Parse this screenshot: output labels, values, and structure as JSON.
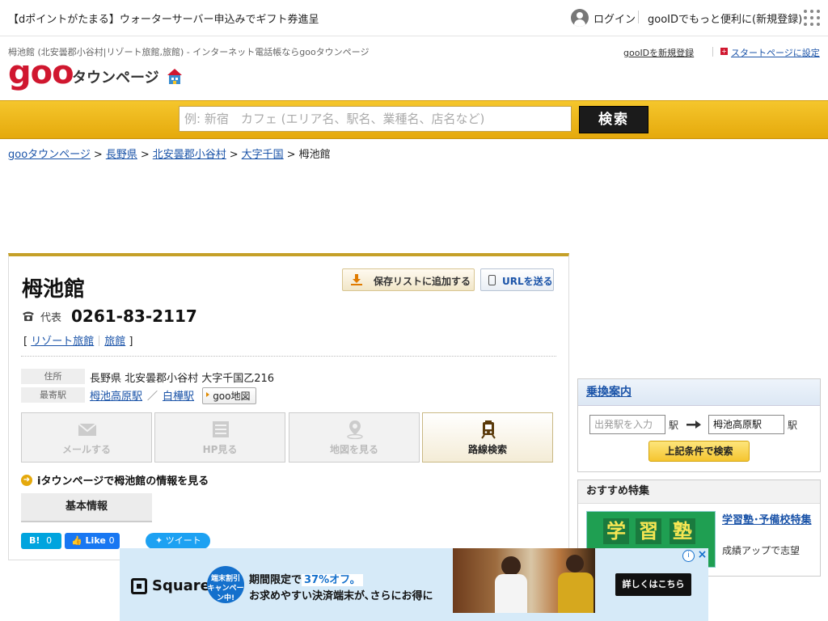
{
  "topbar": {
    "promo": "【dポイントがたまる】ウォーターサーバー申込みでギフト券進呈",
    "login": "ログイン",
    "gooid_promo": "gooIDでもっと便利に(新規登録)"
  },
  "header": {
    "description": "栂池館 (北安曇郡小谷村|リゾート旅館,旅館) - インターネット電話帳ならgooタウンページ",
    "logo_goo": "goo",
    "logo_townpage": "タウンページ",
    "register_link": "gooIDを新規登録",
    "startpage_link": "スタートページに設定"
  },
  "search": {
    "placeholder": "例: 新宿　カフェ (エリア名、駅名、業種名、店名など)",
    "button": "検索"
  },
  "breadcrumb": {
    "items": [
      "gooタウンページ",
      "長野県",
      "北安曇郡小谷村",
      "大字千国"
    ],
    "current": "栂池館",
    "sep": ">"
  },
  "shop": {
    "name": "栂池館",
    "save_button": "保存リストに追加する",
    "url_button": "URLを送る",
    "tel_label": "代表",
    "tel": "0261-83-2117",
    "bracket_open": "[",
    "bracket_close": "]",
    "categories": [
      "リゾート旅館",
      "旅館"
    ],
    "address_label": "住所",
    "address": "長野県 北安曇郡小谷村 大字千国乙216",
    "station_label": "最寄駅",
    "stations": [
      "栂池高原駅",
      "白樺駅"
    ],
    "station_sep": "／",
    "goo_map": "goo地図"
  },
  "actions": {
    "mail": "メールする",
    "hp": "HP見る",
    "map": "地図を見る",
    "route": "路線検索"
  },
  "itownpage": "iタウンページで栂池館の情報を見る",
  "tabs": {
    "basic": "基本情報"
  },
  "social": {
    "hatena": "B!",
    "hatena_count": "0",
    "fb_like": "Like",
    "fb_count": "0",
    "tweet": "ツイート"
  },
  "transit": {
    "title": "乗換案内",
    "from_placeholder": "出発駅を入力",
    "to_value": "栂池高原駅",
    "eki": "駅",
    "search_button": "上記条件で検索"
  },
  "recommend": {
    "title": "おすすめ特集",
    "thumb_chars": [
      "学",
      "習",
      "塾"
    ],
    "feature_title": "学習塾･予備校特集",
    "feature_sub": "成績アップで志望"
  },
  "ad": {
    "brand": "Square",
    "badge": "端末割引 キャンペーン中!",
    "line1_pre": "期間限定で",
    "line1_hl": "37%オフ。",
    "line2": "お求めやすい決済端末が､さらにお得に",
    "button": "詳しくはこちら",
    "info": "i",
    "close": "×"
  },
  "colors": {
    "accent_yellow": "#f5c62c",
    "logo_red": "#d0172f",
    "link_blue": "#1a53a8",
    "card_gold": "#c5a028"
  }
}
